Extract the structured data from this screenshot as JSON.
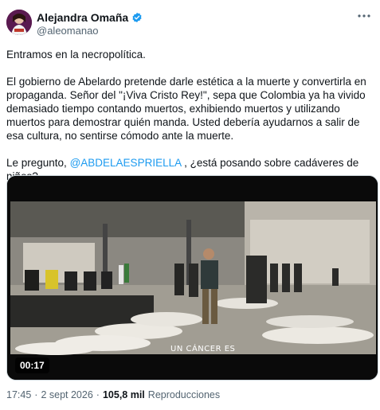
{
  "author": {
    "name": "Alejandra Omaña",
    "handle": "@aleomanao",
    "avatar": "avatar",
    "verified_icon": "verified-badge-icon"
  },
  "more_icon": "more-options-icon",
  "tweet": {
    "para1": "Entramos en la necropolítica.",
    "para2": "El gobierno de Abelardo pretende darle estética a la muerte y convertirla en propaganda. Señor del \"¡Viva Cristo Rey!\", sepa que Colombia ya ha vivido demasiado tiempo contando muertos, exhibiendo muertos y utilizando muertos para demostrar quién manda. Usted debería ayudarnos a salir de esa cultura, no sentirse cómodo ante la muerte.",
    "para3_prefix": "Le pregunto, ",
    "para3_mention": "@ABDELAESPRIELLA",
    "para3_suffix": " , ¿está posando sobre cadáveres de niños?"
  },
  "video": {
    "duration": "00:17",
    "caption": "UN CÁNCER ES"
  },
  "meta": {
    "time": "17:45",
    "dot1": "·",
    "date": "2 sept 2026",
    "dot2": "·",
    "views": "105,8 mil",
    "views_label": "Reproducciones"
  },
  "colors": {
    "accent": "#1d9bf0",
    "text": "#0f1419",
    "secondary": "#536471"
  }
}
